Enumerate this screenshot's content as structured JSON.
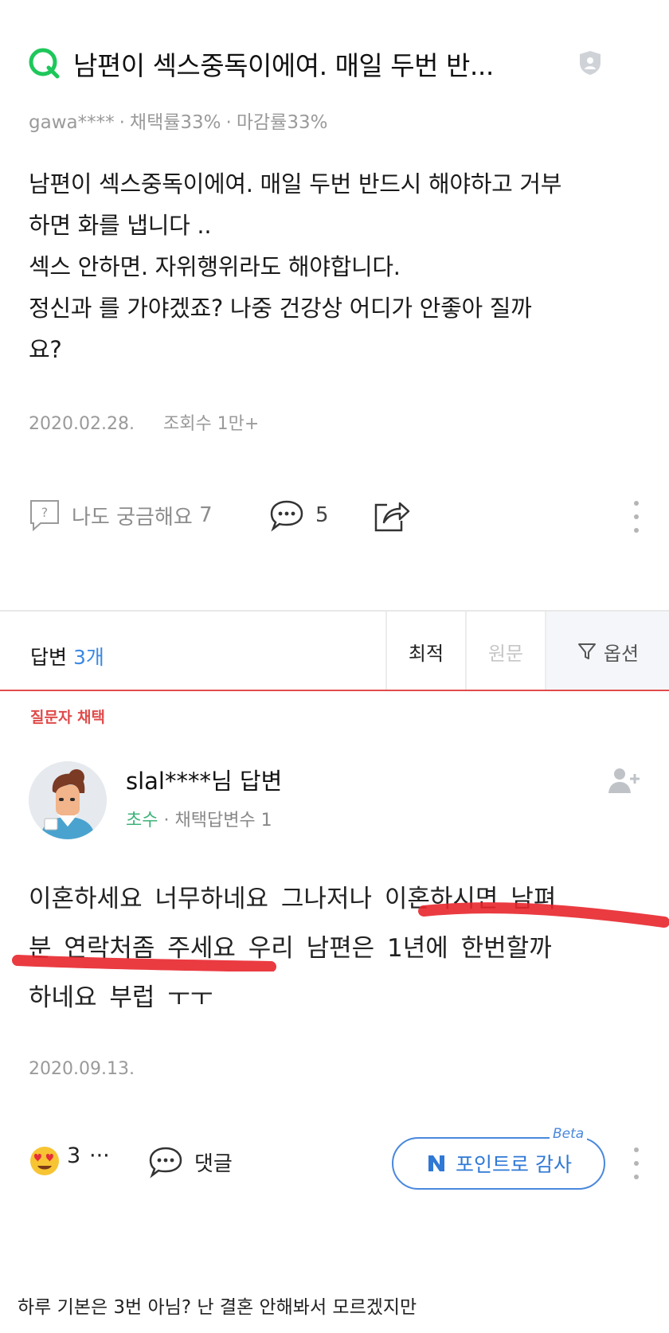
{
  "question": {
    "title": "남편이 섹스중독이에여. 매일 두번 반...",
    "author": "gawa****",
    "adopt_rate": "채택률33%",
    "close_rate": "마감률33%",
    "body_lines": [
      "남편이 섹스중독이에여. 매일 두번 반드시 해야하고 거부",
      "하면 화를 냅니다 ..",
      "섹스 안하면. 자위행위라도 해야합니다.",
      "정신과 를 가야겠죠? 나중 건강상 어디가 안좋아 질까",
      "요?"
    ],
    "date": "2020.02.28.",
    "views": "조회수 1만+",
    "curious_label": "나도 궁금해요",
    "curious_count": "7",
    "comment_count": "5"
  },
  "answers_bar": {
    "label": "답변",
    "count": "3개",
    "tab_best": "최적",
    "tab_original": "원문",
    "tab_options": "옵션"
  },
  "answer": {
    "badge": "질문자 채택",
    "name": "slal****님 답변",
    "grade": "초수",
    "stat": "채택답변수 1",
    "text_lines": [
      "이혼하세요  너무하네요  그나저나  이혼하시면  남펴",
      "분  연락처좀  주세요  우리  남편은  1년에  한번할까",
      "하네요  부럽  ㅜㅜ"
    ],
    "date": "2020.09.13.",
    "reaction_count": "3",
    "reaction_more": "···",
    "comment_label": "댓글",
    "point_button": "포인트로 감사",
    "beta": "Beta"
  },
  "footer_caption": "하루 기본은 3번 아님?  난 결혼 안해봐서 모르겠지만",
  "colors": {
    "q_green": "#1ec75a",
    "answer_count_blue": "#3a88e6",
    "adopt_red": "#e14b4b",
    "grade_green": "#3fb37a",
    "point_blue": "#2f78d5",
    "highlight_red": "#e8262c"
  }
}
